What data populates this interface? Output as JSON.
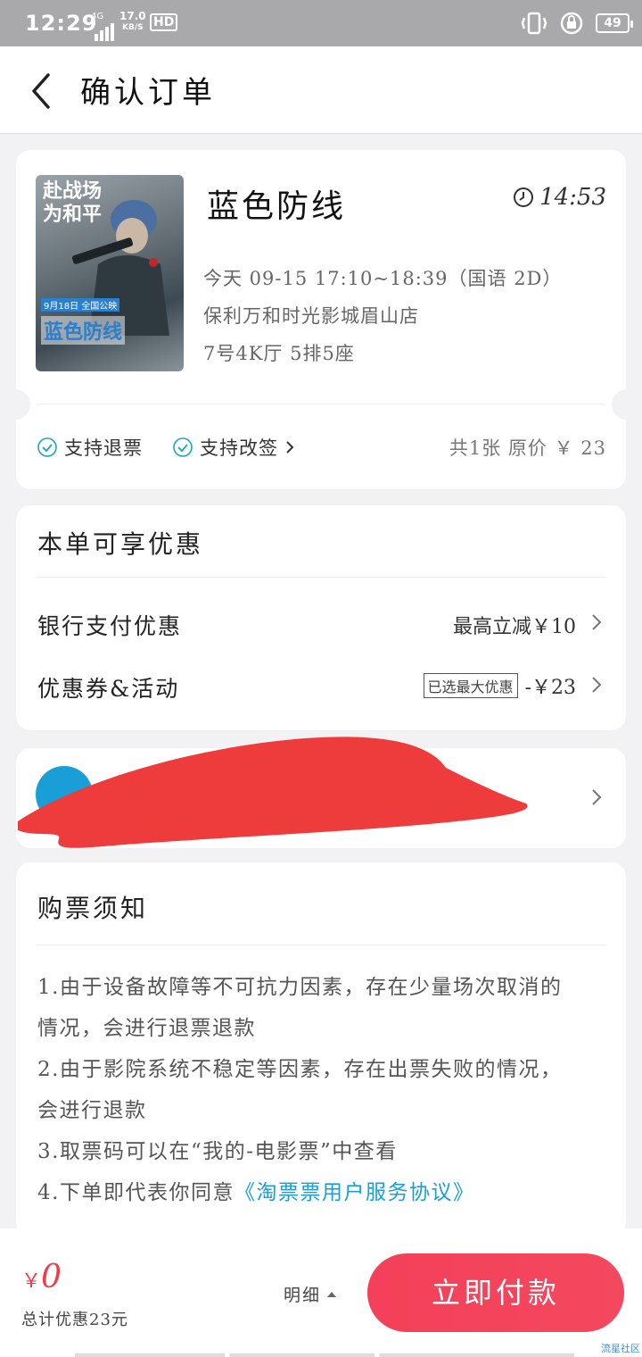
{
  "status_bar": {
    "time": "12:29",
    "network": "4G",
    "speed_value": "17.0",
    "speed_unit": "KB/S",
    "hd": "HD",
    "battery": "49"
  },
  "nav": {
    "title": "确认订单",
    "back_icon": "chevron-left-icon"
  },
  "movie": {
    "title": "蓝色防线",
    "countdown": "14:53",
    "showtime": "今天  09-15  17:10~18:39（国语  2D）",
    "cinema": "保利万和时光影城眉山店",
    "seat": "7号4K厅  5排5座",
    "poster_text_top": "赴战场\n为和平",
    "poster_date": "9月18日 全国公映",
    "poster_brand": "蓝色防线",
    "refund": "支持退票",
    "change": "支持改签",
    "count_price": "共1张  原价  ￥  23"
  },
  "discount": {
    "title": "本单可享优惠",
    "bank_label": "银行支付优惠",
    "bank_value": "最高立减￥10",
    "coupon_label": "优惠券&活动",
    "coupon_tag": "已选最大优惠",
    "coupon_value": "-￥23"
  },
  "notice": {
    "title": "购票须知",
    "line1a": "1.由于设备故障等不可抗力因素，存在少量场次取消的",
    "line1b": "情况，会进行退票退款",
    "line2a": "2.由于影院系统不稳定等因素，存在出票失败的情况，",
    "line2b": "会进行退款",
    "line3": "3.取票码可以在“我的-电影票”中查看",
    "line4_prefix": "4.下单即代表你同意",
    "line4_link": "《淘票票用户服务协议》"
  },
  "bottom": {
    "currency": "￥",
    "total": "0",
    "saved": "总计优惠23元",
    "detail": "明细",
    "pay": "立即付款"
  },
  "watermark": "流星社区",
  "colors": {
    "accent": "#f4405a",
    "link": "#1a9ed8",
    "check": "#1aa8b8"
  }
}
